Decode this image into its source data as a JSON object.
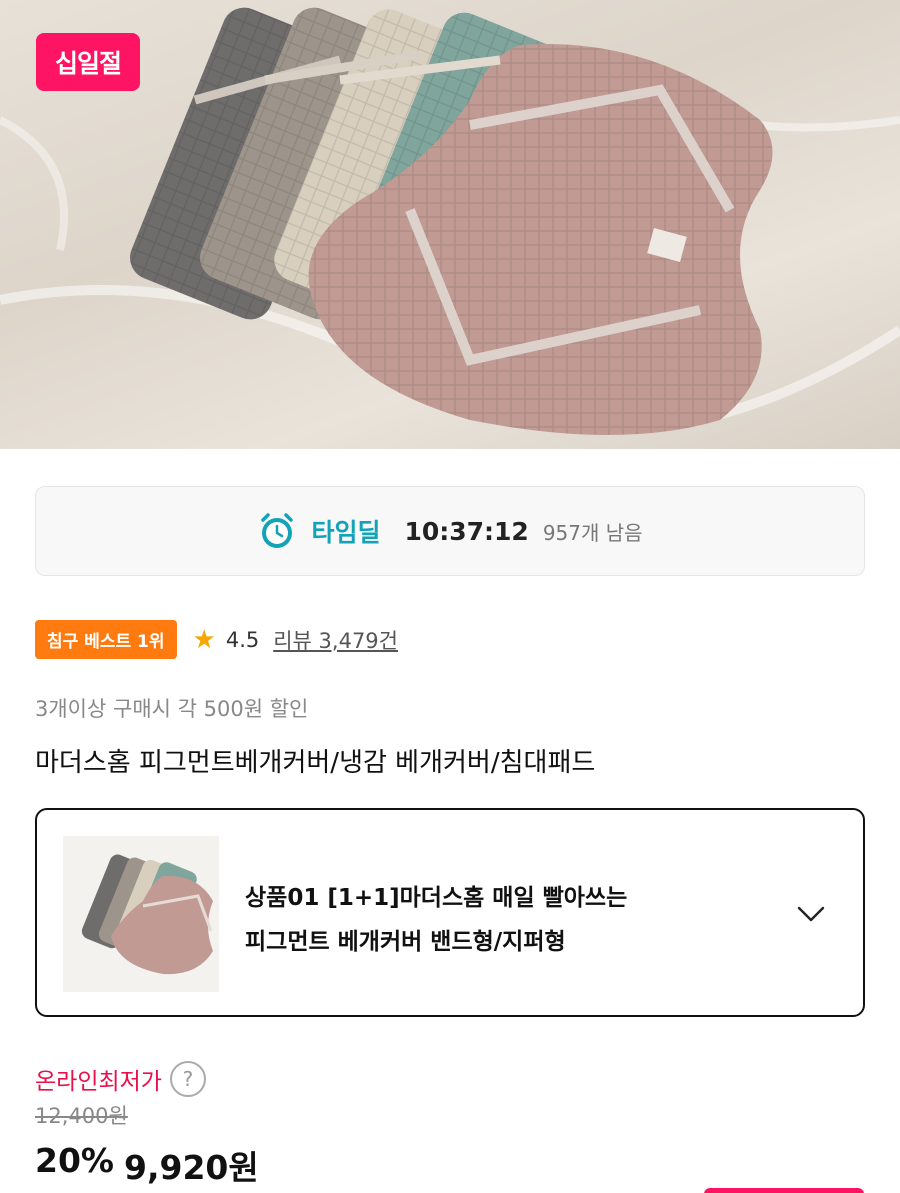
{
  "hero": {
    "promo_badge": "십일절"
  },
  "timedeal": {
    "icon": "alarm-clock-icon",
    "label": "타임딜",
    "countdown": "10:37:12",
    "remaining": "957개 남음"
  },
  "rank": {
    "badge": "침구 베스트 1위",
    "rating": "4.5",
    "reviews": "리뷰 3,479건"
  },
  "promo_text": "3개이상 구매시 각 500원 할인",
  "product_title": "마더스홈 피그먼트베개커버/냉감 베개커버/침대패드",
  "option": {
    "line1": "상품01 [1+1]마더스홈 매일 빨아쓰는",
    "line2": "피그먼트 베개커버 밴드형/지퍼형"
  },
  "price": {
    "label": "온라인최저가",
    "help": "?",
    "original": "12,400원",
    "discount": "20%",
    "final": "9,920원"
  },
  "colors": {
    "brand_pink": "#ff1463",
    "timedeal_teal": "#13a3b8",
    "rank_orange": "#ff7b10",
    "price_red": "#e8114c"
  }
}
